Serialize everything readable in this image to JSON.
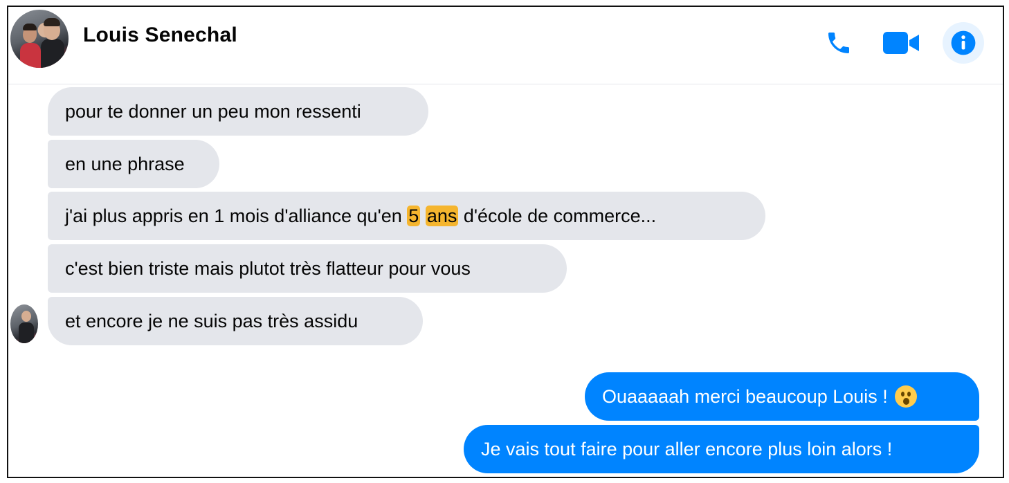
{
  "header": {
    "contact_name": "Louis Senechal",
    "icons": [
      "phone-icon",
      "video-camera-icon",
      "info-icon"
    ],
    "accent_color": "#0084ff"
  },
  "messages": {
    "incoming": [
      "pour te donner un peu mon ressenti",
      "en une phrase",
      {
        "before": "j'ai plus appris en 1 mois d'alliance qu'en ",
        "highlight1": "5",
        "highlight2": "ans",
        "after": " d'école de commerce..."
      },
      "c'est bien triste mais plutot très flatteur pour vous",
      "et encore je ne suis pas très assidu"
    ],
    "outgoing": [
      {
        "text": "Ouaaaaah merci beaucoup Louis ! ",
        "emoji": "astonished-face-emoji"
      },
      {
        "text": "Je vais tout faire pour aller encore plus loin alors !"
      }
    ]
  },
  "colors": {
    "incoming_bubble": "#e4e6eb",
    "outgoing_bubble": "#0084ff",
    "highlight": "#f5b52e"
  }
}
